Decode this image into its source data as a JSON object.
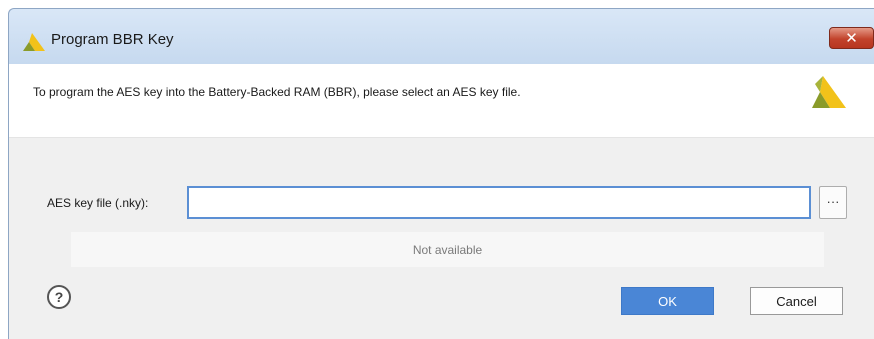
{
  "window": {
    "title": "Program BBR Key",
    "close_symbol": "✕"
  },
  "header": {
    "description": "To program the AES key into the Battery-Backed RAM (BBR), please select an AES key file."
  },
  "form": {
    "key_file_label": "AES key file (.nky):",
    "key_file_value": "",
    "browse_label": "···"
  },
  "status": {
    "message": "Not available"
  },
  "footer": {
    "help_label": "?",
    "ok_label": "OK",
    "cancel_label": "Cancel"
  },
  "icons": {
    "title_logo": "vivado-logo-icon",
    "header_logo": "vivado-logo-icon",
    "close": "close-icon",
    "help": "help-icon"
  },
  "colors": {
    "accent": "#4a86d6",
    "input_border": "#5b8fd4",
    "close_button": "#c2432c",
    "logo_yellow": "#f2c21a",
    "logo_green": "#8a9b2a"
  }
}
